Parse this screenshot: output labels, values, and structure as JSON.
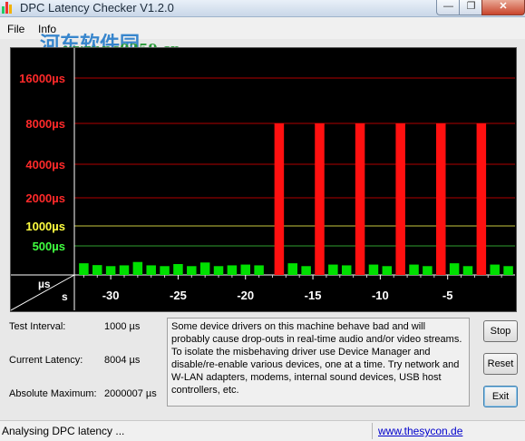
{
  "window": {
    "title": "DPC Latency Checker V1.2.0",
    "min_symbol": "—",
    "max_symbol": "❐",
    "close_symbol": "✕"
  },
  "menu": {
    "file": "File",
    "info": "Info"
  },
  "watermark": {
    "brand": "河东软件园",
    "url": "www.pc0359.cn"
  },
  "chart": {
    "ylabels": [
      {
        "text": "16000µs",
        "color": "#ff2a2a"
      },
      {
        "text": "8000µs",
        "color": "#ff2a2a"
      },
      {
        "text": "4000µs",
        "color": "#ff2a2a"
      },
      {
        "text": "2000µs",
        "color": "#ff2a2a"
      },
      {
        "text": "1000µs",
        "color": "#ffff40"
      },
      {
        "text": "500µs",
        "color": "#40ff40"
      }
    ],
    "corner_unit_y": "µs",
    "corner_unit_x": "s",
    "xticks": [
      "-30",
      "-25",
      "-20",
      "-15",
      "-10",
      "-5"
    ]
  },
  "chart_data": {
    "type": "bar",
    "ylabels_us": [
      16000,
      8000,
      4000,
      2000,
      1000,
      500
    ],
    "xlabel_unit": "s",
    "ylabel_unit": "µs",
    "xticks": [
      -30,
      -25,
      -20,
      -15,
      -10,
      -5
    ],
    "xlim": [
      -32.7,
      0
    ],
    "ylim": [
      0,
      8000
    ],
    "low_bar_level": 0.35,
    "bars": [
      {
        "x": -32.0,
        "v": 0.45
      },
      {
        "x": -31.0,
        "v": 0.38
      },
      {
        "x": -30.0,
        "v": 0.34
      },
      {
        "x": -29.0,
        "v": 0.37
      },
      {
        "x": -28.0,
        "v": 0.5
      },
      {
        "x": -27.0,
        "v": 0.37
      },
      {
        "x": -26.0,
        "v": 0.34
      },
      {
        "x": -25.0,
        "v": 0.42
      },
      {
        "x": -24.0,
        "v": 0.34
      },
      {
        "x": -23.0,
        "v": 0.48
      },
      {
        "x": -22.0,
        "v": 0.34
      },
      {
        "x": -21.0,
        "v": 0.37
      },
      {
        "x": -20.0,
        "v": 0.4
      },
      {
        "x": -19.0,
        "v": 0.37
      },
      {
        "x": -17.5,
        "v": 8000
      },
      {
        "x": -16.5,
        "v": 0.45
      },
      {
        "x": -15.5,
        "v": 0.34
      },
      {
        "x": -14.5,
        "v": 8000
      },
      {
        "x": -13.5,
        "v": 0.4
      },
      {
        "x": -12.5,
        "v": 0.37
      },
      {
        "x": -11.5,
        "v": 8000
      },
      {
        "x": -10.5,
        "v": 0.4
      },
      {
        "x": -9.5,
        "v": 0.34
      },
      {
        "x": -8.5,
        "v": 8000
      },
      {
        "x": -7.5,
        "v": 0.4
      },
      {
        "x": -6.5,
        "v": 0.34
      },
      {
        "x": -5.5,
        "v": 8000
      },
      {
        "x": -4.5,
        "v": 0.45
      },
      {
        "x": -3.5,
        "v": 0.34
      },
      {
        "x": -2.5,
        "v": 8000
      },
      {
        "x": -1.5,
        "v": 0.4
      },
      {
        "x": -0.5,
        "v": 0.34
      }
    ],
    "colors": {
      "high": "#ff1010",
      "low": "#00e000",
      "grid_red": "#b00000",
      "grid_yellow": "#c8c840",
      "grid_green": "#30a030"
    }
  },
  "stats": {
    "test_interval_label": "Test Interval:",
    "test_interval_value": "1000 µs",
    "current_latency_label": "Current Latency:",
    "current_latency_value": "8004 µs",
    "absolute_maximum_label": "Absolute Maximum:",
    "absolute_maximum_value": "2000007 µs"
  },
  "description": "Some device drivers on this machine behave bad and will probably cause drop-outs in real-time audio and/or video streams. To isolate the misbehaving driver use Device Manager and disable/re-enable various devices, one at a time. Try network and W-LAN adapters, modems, internal sound devices, USB host controllers, etc.",
  "buttons": {
    "stop": "Stop",
    "reset": "Reset",
    "exit": "Exit"
  },
  "status": {
    "text": "Analysing DPC latency ...",
    "link": "www.thesycon.de"
  }
}
